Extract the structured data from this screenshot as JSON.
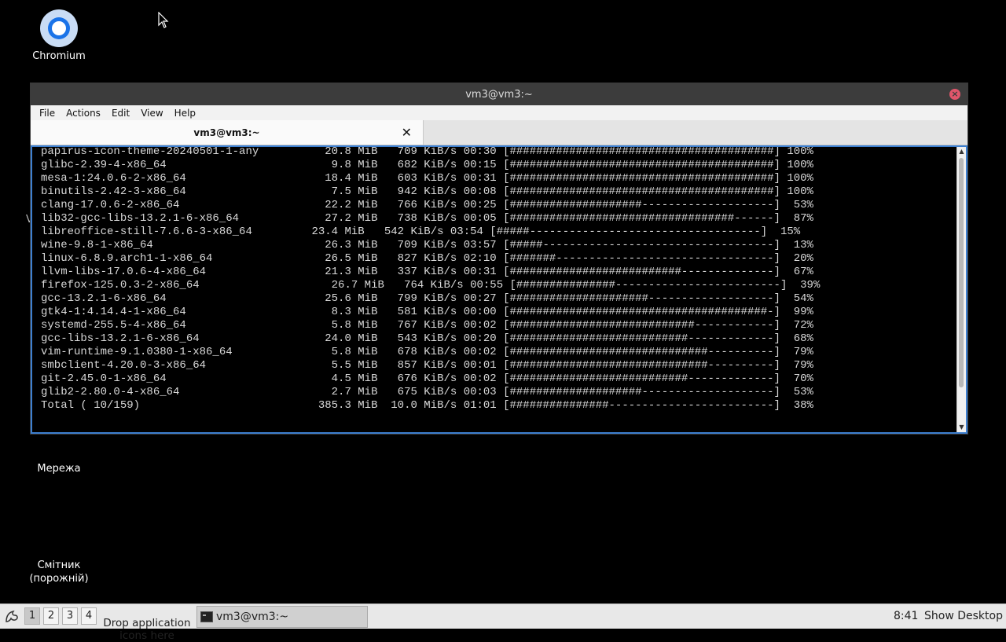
{
  "desktop": {
    "icons": [
      {
        "label": "Chromium"
      },
      {
        "label": "Мережа"
      },
      {
        "label": "Смітник\n(порожній)"
      }
    ],
    "stray_text": "V"
  },
  "window": {
    "title": "vm3@vm3:~",
    "menu": [
      "File",
      "Actions",
      "Edit",
      "View",
      "Help"
    ],
    "tab_label": "vm3@vm3:~",
    "terminal_lines": [
      "papirus-icon-theme-20240501-1-any          20.8 MiB   709 KiB/s 00:30 [########################################] 100%",
      "glibc-2.39-4-x86_64                         9.8 MiB   682 KiB/s 00:15 [########################################] 100%",
      "mesa-1:24.0.6-2-x86_64                     18.4 MiB   603 KiB/s 00:31 [########################################] 100%",
      "binutils-2.42-3-x86_64                      7.5 MiB   942 KiB/s 00:08 [########################################] 100%",
      "clang-17.0.6-2-x86_64                      22.2 MiB   766 KiB/s 00:25 [####################--------------------]  53%",
      "lib32-gcc-libs-13.2.1-6-x86_64             27.2 MiB   738 KiB/s 00:05 [##################################------]  87%",
      "libreoffice-still-7.6.6-3-x86_64         23.4 MiB   542 KiB/s 03:54 [#####-----------------------------------]  15%",
      "wine-9.8-1-x86_64                          26.3 MiB   709 KiB/s 03:57 [#####-----------------------------------]  13%",
      "linux-6.8.9.arch1-1-x86_64                 26.5 MiB   827 KiB/s 02:10 [#######---------------------------------]  20%",
      "llvm-libs-17.0.6-4-x86_64                  21.3 MiB   337 KiB/s 00:31 [##########################--------------]  67%",
      "firefox-125.0.3-2-x86_64                    26.7 MiB   764 KiB/s 00:55 [###############-------------------------]  39%",
      "gcc-13.2.1-6-x86_64                        25.6 MiB   799 KiB/s 00:27 [#####################-------------------]  54%",
      "gtk4-1:4.14.4-1-x86_64                      8.3 MiB   581 KiB/s 00:00 [#######################################-]  99%",
      "systemd-255.5-4-x86_64                      5.8 MiB   767 KiB/s 00:02 [############################------------]  72%",
      "gcc-libs-13.2.1-6-x86_64                   24.0 MiB   543 KiB/s 00:20 [###########################-------------]  68%",
      "vim-runtime-9.1.0380-1-x86_64               5.8 MiB   678 KiB/s 00:02 [##############################----------]  79%",
      "smbclient-4.20.0-3-x86_64                   5.5 MiB   857 KiB/s 00:01 [##############################----------]  79%",
      "git-2.45.0-1-x86_64                         4.5 MiB   676 KiB/s 00:02 [###########################-------------]  70%",
      "glib2-2.80.0-4-x86_64                       2.7 MiB   675 KiB/s 00:03 [####################--------------------]  53%",
      "Total ( 10/159)                           385.3 MiB  10.0 MiB/s 01:01 [###############-------------------------]  38%"
    ]
  },
  "taskbar": {
    "workspaces": [
      "1",
      "2",
      "3",
      "4"
    ],
    "active_workspace": "1",
    "drop_apps": "Drop application\nicons here",
    "task_label": "vm3@vm3:~",
    "clock": "8:41",
    "show_desktop": "Show Desktop"
  },
  "colors": {
    "terminal_bg": "#000000",
    "terminal_fg": "#d8d8d8",
    "terminal_border": "#3d7fd0",
    "titlebar": "#3c3c3c",
    "close_button": "#e0566b",
    "taskbar": "#e8e8e8"
  }
}
